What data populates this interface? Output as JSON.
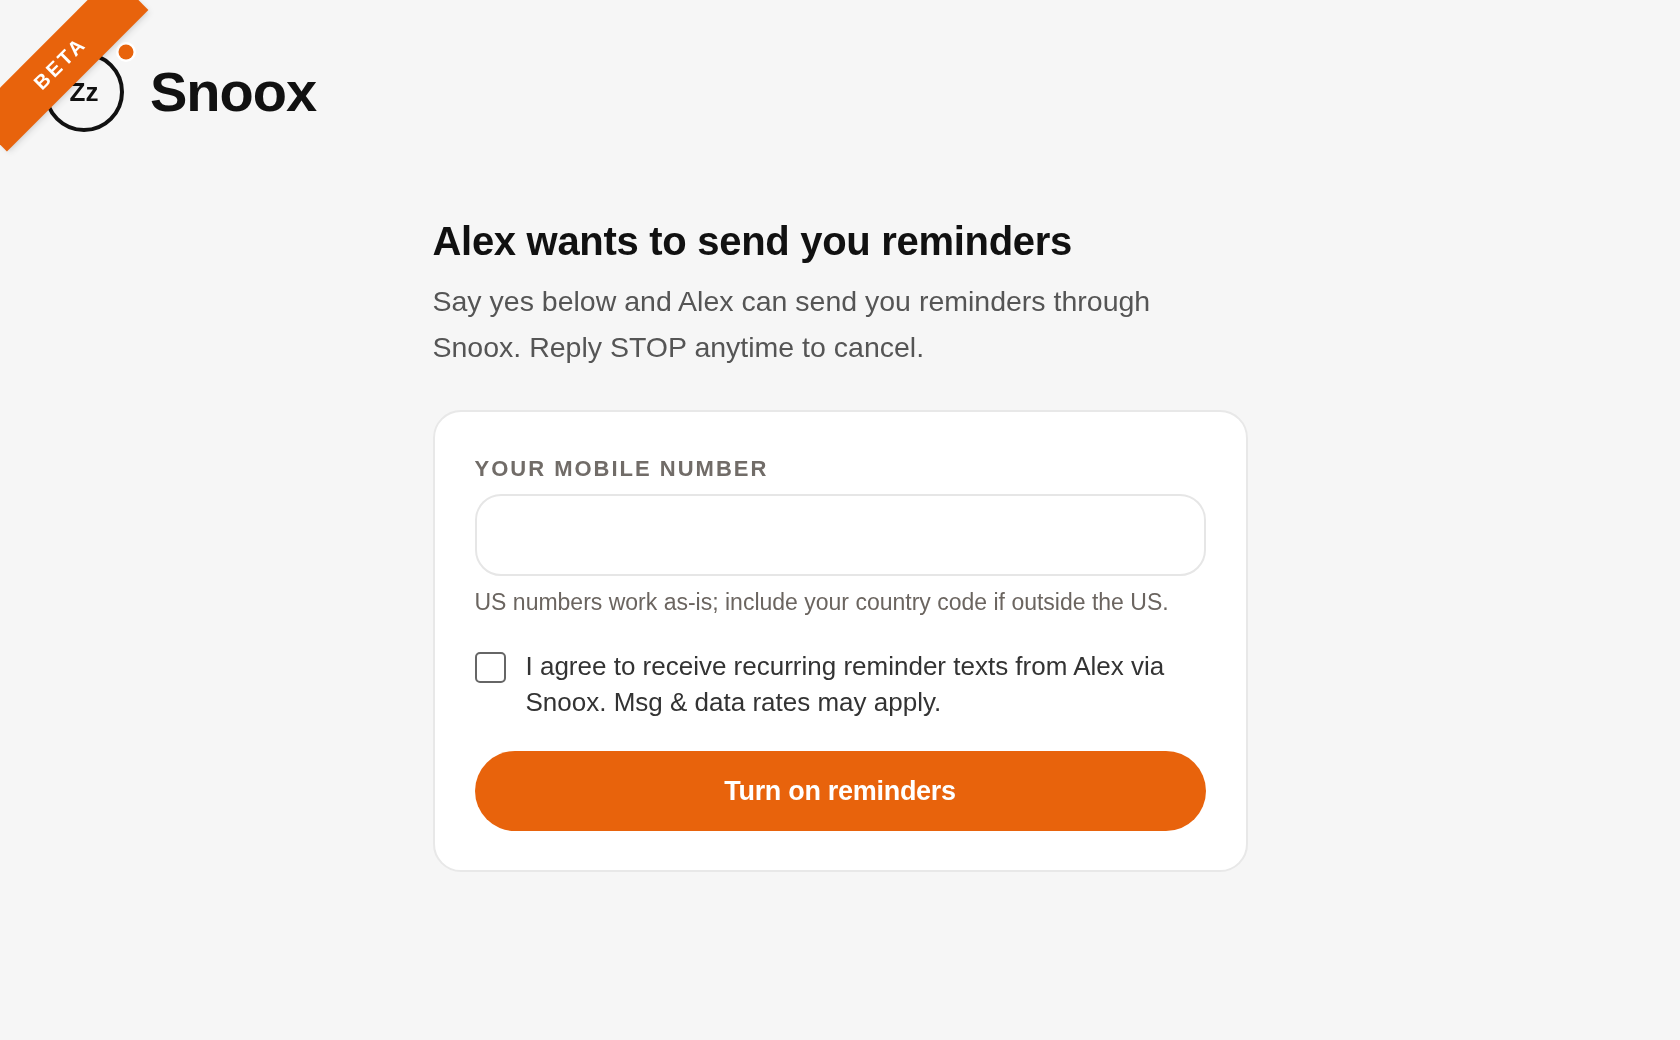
{
  "ribbon": {
    "label": "BETA"
  },
  "logo": {
    "mark_text": "Zz",
    "wordmark": "Snoox"
  },
  "heading": "Alex wants to send you reminders",
  "intro": "Say yes below and Alex can send you reminders through Snoox. Reply STOP anytime to cancel.",
  "form": {
    "phone_field": {
      "label": "YOUR MOBILE NUMBER",
      "hint": "US numbers work as-is; include your country code if outside the US."
    },
    "consent": {
      "checked": false,
      "label": "I agree to receive recurring reminder texts from Alex via Snoox. Msg & data rates may apply."
    },
    "submit_button": {
      "label": "Turn on reminders"
    }
  }
}
